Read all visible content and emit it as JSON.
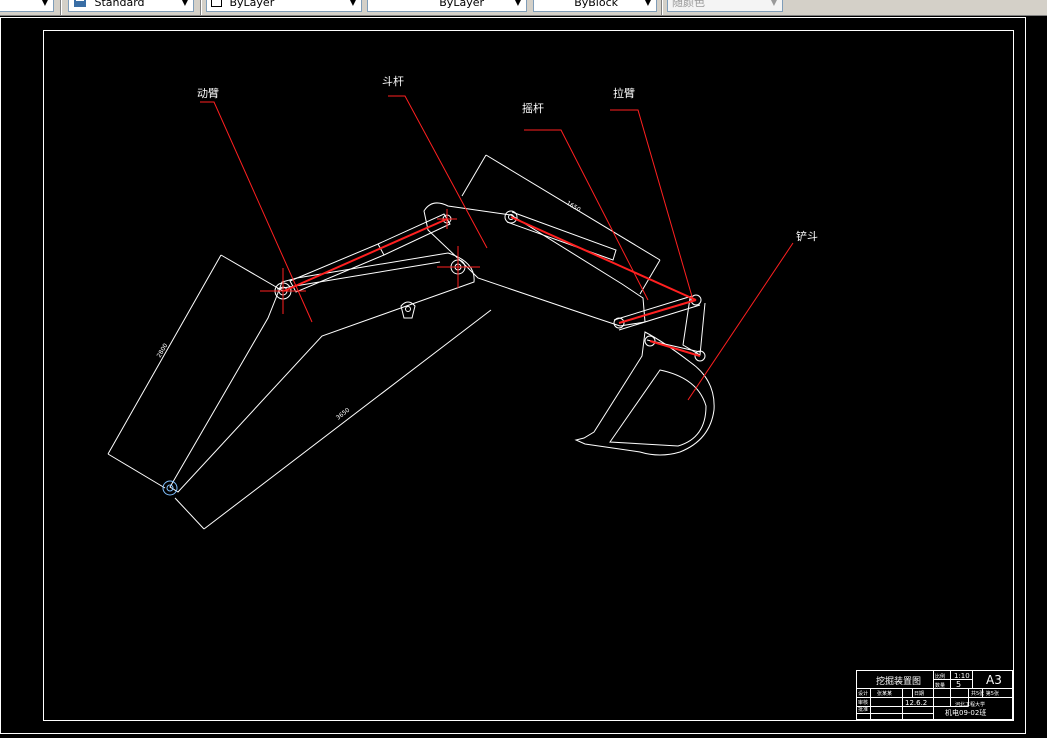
{
  "toolbar": {
    "text_style": "Standard",
    "layer_color": "ByLayer",
    "linetype": "ByLayer",
    "lineweight": "ByBlock",
    "plot_style": "随颜色"
  },
  "drawing": {
    "labels": {
      "boom": "动臂",
      "stick": "斗杆",
      "rocker": "摇杆",
      "link": "拉臂",
      "bucket": "铲斗"
    },
    "dimensions": {
      "boom_side": "2800",
      "boom_long": "3650",
      "stick_len": "1650"
    },
    "title_block": {
      "title": "挖掘装置图",
      "scale_label": "比例",
      "scale": "1:10",
      "qty_label": "数量",
      "qty": "5",
      "sheet_size": "A3",
      "designer_label": "设计",
      "designer": "张某某",
      "date_label": "日期",
      "date": "12.6.2",
      "checker_label": "审核",
      "approver_label": "批准",
      "sheet_info": "共5张 第5张",
      "school": "河北工程大学",
      "drawing_no": "机电09-02班"
    }
  }
}
